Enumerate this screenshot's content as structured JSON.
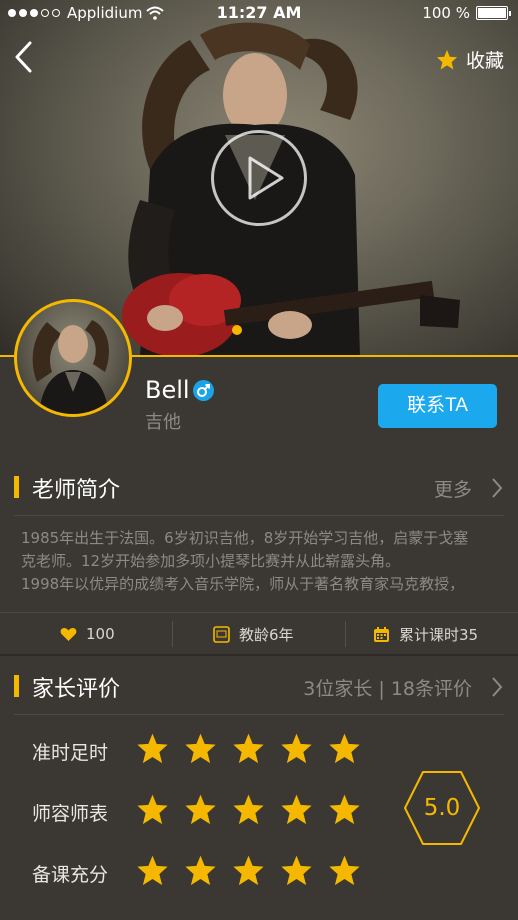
{
  "status_bar": {
    "carrier": "Applidium",
    "time": "11:27 AM",
    "battery": "100 %"
  },
  "header": {
    "favorite_label": "收藏"
  },
  "teacher": {
    "name": "Bell",
    "subject": "吉他",
    "contact_label": "联系TA"
  },
  "intro_section": {
    "title": "老师简介",
    "more_label": "更多",
    "lines": [
      "1985年出生于法国。6岁初识吉他，8岁开始学习吉他，启蒙于戈塞",
      "克老师。12岁开始参加多项小提琴比赛并从此崭露头角。",
      "1998年以优异的成绩考入音乐学院，师从于著名教育家马克教授，"
    ]
  },
  "stats": {
    "likes": "100",
    "teaching_age": "教龄6年",
    "total_hours": "累计课时35"
  },
  "reviews_section": {
    "title": "家长评价",
    "summary": "3位家长 | 18条评价",
    "ratings": [
      {
        "label": "准时足时",
        "stars": 5
      },
      {
        "label": "师容师表",
        "stars": 5
      },
      {
        "label": "备课充分",
        "stars": 5
      }
    ],
    "score": "5.0"
  },
  "colors": {
    "accent": "#f5b800",
    "button": "#1ba8ec",
    "background": "#3b3733",
    "muted_text": "#8c8a85"
  },
  "icons": [
    "back-icon",
    "star-icon",
    "play-icon",
    "male-icon",
    "heart-icon",
    "certificate-icon",
    "calendar-icon",
    "chevron-right-icon",
    "wifi-icon",
    "battery-icon"
  ]
}
